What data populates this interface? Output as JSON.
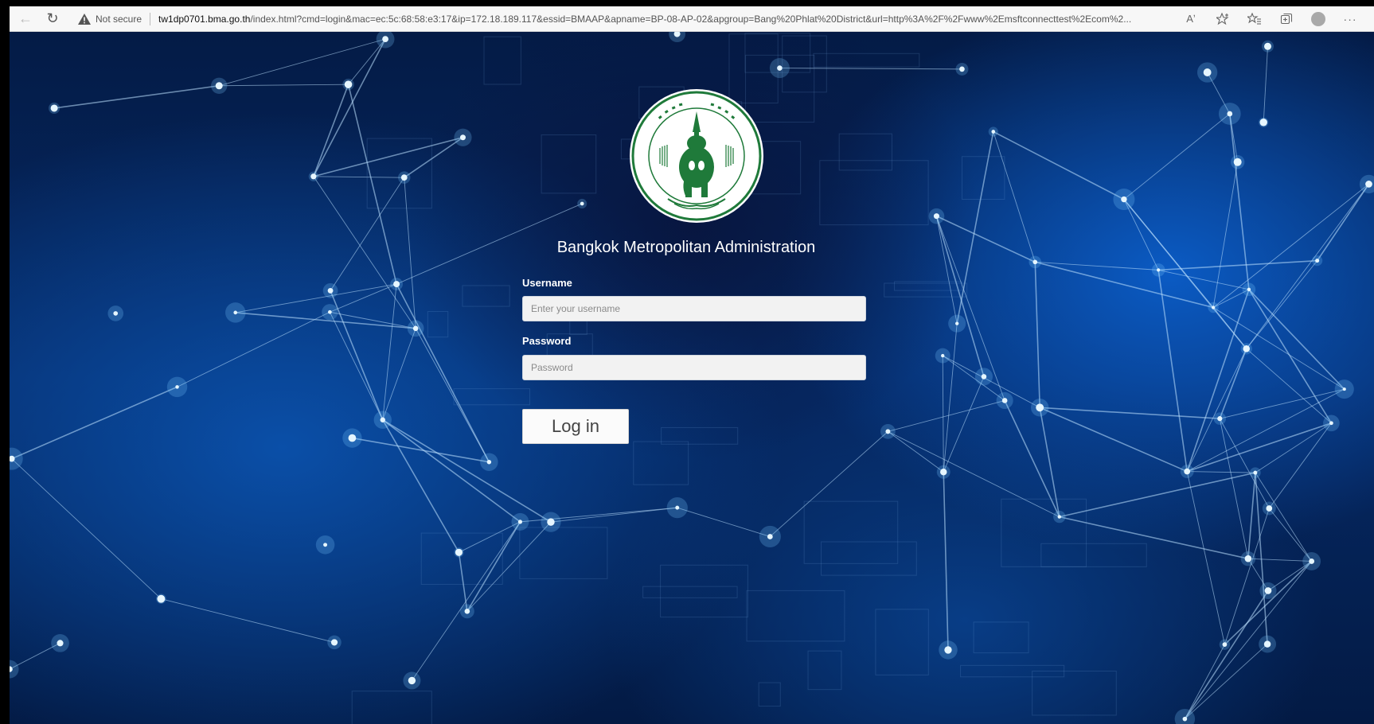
{
  "browser": {
    "security_label": "Not secure",
    "url_host": "tw1dp0701.bma.go.th",
    "url_path": "/index.html?cmd=login&mac=ec:5c:68:58:e3:17&ip=172.18.189.117&essid=BMAAP&apname=BP-08-AP-02&apgroup=Bang%20Phlat%20District&url=http%3A%2F%2Fwww%2Emsftconnecttest%2Ecom%2...",
    "icons": [
      "back-icon",
      "refresh-icon",
      "warning-icon",
      "read-aloud-icon",
      "add-favorite-icon",
      "favorites-icon",
      "collections-icon",
      "profile-icon",
      "more-icon"
    ],
    "read_aloud_glyph": "Aʼ",
    "more_glyph": "···"
  },
  "login": {
    "org_name": "Bangkok Metropolitan Administration",
    "username_label": "Username",
    "username_placeholder": "Enter your username",
    "username_value": "",
    "password_label": "Password",
    "password_placeholder": "Password",
    "password_value": "",
    "login_button": "Log in"
  },
  "colors": {
    "logo_green": "#1f7a3a",
    "background_blue": "#0a4fa8",
    "label_white": "#ffffff"
  }
}
